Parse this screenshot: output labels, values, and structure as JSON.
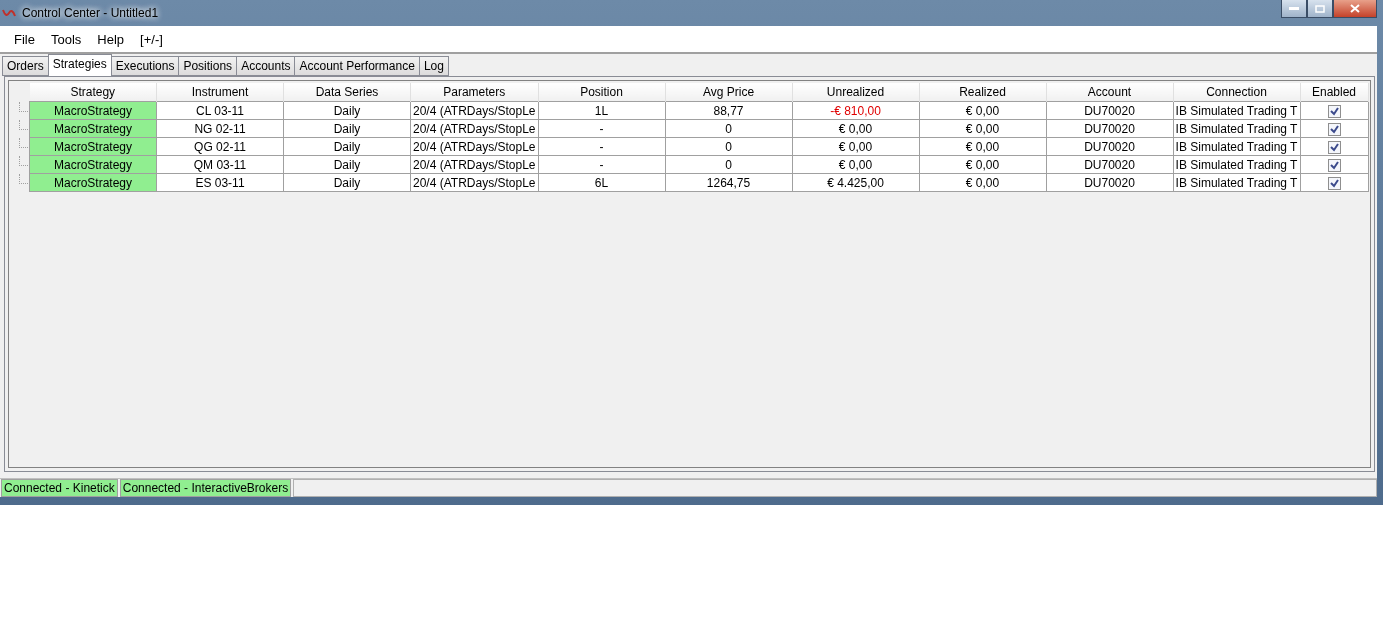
{
  "window": {
    "title": "Control Center - Untitled1"
  },
  "menu": [
    "File",
    "Tools",
    "Help",
    "[+/-]"
  ],
  "tabs": [
    {
      "label": "Orders",
      "selected": false
    },
    {
      "label": "Strategies",
      "selected": true
    },
    {
      "label": "Executions",
      "selected": false
    },
    {
      "label": "Positions",
      "selected": false
    },
    {
      "label": "Accounts",
      "selected": false
    },
    {
      "label": "Account Performance",
      "selected": false
    },
    {
      "label": "Log",
      "selected": false
    }
  ],
  "table": {
    "columns": [
      "Strategy",
      "Instrument",
      "Data Series",
      "Parameters",
      "Position",
      "Avg Price",
      "Unrealized",
      "Realized",
      "Account",
      "Connection",
      "Enabled"
    ],
    "rows": [
      {
        "strategy": "MacroStrategy",
        "instrument": "CL 03-11",
        "data_series": "Daily",
        "parameters": "20/4 (ATRDays/StopLe",
        "position": "1L",
        "avg_price": "88,77",
        "unrealized": "-€ 810,00",
        "loss": true,
        "realized": "€ 0,00",
        "account": "DU70020",
        "connection": "IB Simulated Trading T",
        "enabled": true
      },
      {
        "strategy": "MacroStrategy",
        "instrument": "NG 02-11",
        "data_series": "Daily",
        "parameters": "20/4 (ATRDays/StopLe",
        "position": "-",
        "avg_price": "0",
        "unrealized": "€ 0,00",
        "loss": false,
        "realized": "€ 0,00",
        "account": "DU70020",
        "connection": "IB Simulated Trading T",
        "enabled": true
      },
      {
        "strategy": "MacroStrategy",
        "instrument": "QG 02-11",
        "data_series": "Daily",
        "parameters": "20/4 (ATRDays/StopLe",
        "position": "-",
        "avg_price": "0",
        "unrealized": "€ 0,00",
        "loss": false,
        "realized": "€ 0,00",
        "account": "DU70020",
        "connection": "IB Simulated Trading T",
        "enabled": true
      },
      {
        "strategy": "MacroStrategy",
        "instrument": "QM 03-11",
        "data_series": "Daily",
        "parameters": "20/4 (ATRDays/StopLe",
        "position": "-",
        "avg_price": "0",
        "unrealized": "€ 0,00",
        "loss": false,
        "realized": "€ 0,00",
        "account": "DU70020",
        "connection": "IB Simulated Trading T",
        "enabled": true
      },
      {
        "strategy": "MacroStrategy",
        "instrument": "ES 03-11",
        "data_series": "Daily",
        "parameters": "20/4 (ATRDays/StopLe",
        "position": "6L",
        "avg_price": "1264,75",
        "unrealized": "€ 4.425,00",
        "loss": false,
        "realized": "€ 0,00",
        "account": "DU70020",
        "connection": "IB Simulated Trading T",
        "enabled": true
      }
    ]
  },
  "status_bar": [
    "Connected - Kinetick",
    "Connected - InteractiveBrokers"
  ]
}
